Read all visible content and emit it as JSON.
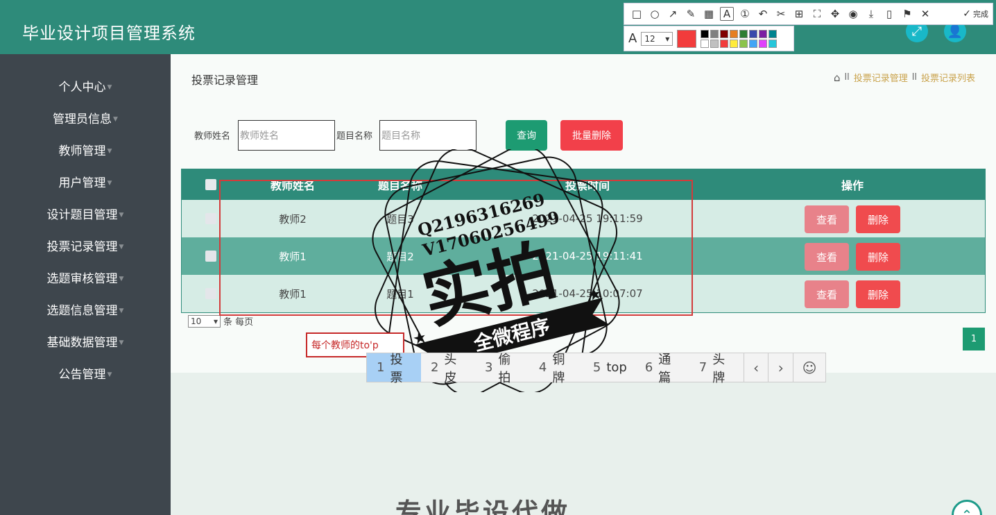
{
  "app": {
    "title": "毕业设计项目管理系统"
  },
  "header": {
    "fullscreen_icon": "expand-icon",
    "user_icon": "user-icon"
  },
  "sidebar": {
    "items": [
      {
        "label": "个人中心"
      },
      {
        "label": "管理员信息"
      },
      {
        "label": "教师管理"
      },
      {
        "label": "用户管理"
      },
      {
        "label": "设计题目管理"
      },
      {
        "label": "投票记录管理"
      },
      {
        "label": "选题审核管理"
      },
      {
        "label": "选题信息管理"
      },
      {
        "label": "基础数据管理"
      },
      {
        "label": "公告管理"
      }
    ]
  },
  "page": {
    "title": "投票记录管理",
    "breadcrumb": {
      "sep": "ll",
      "items": [
        "投票记录管理",
        "投票记录列表"
      ]
    }
  },
  "search": {
    "teacher_label": "教师姓名",
    "teacher_placeholder": "教师姓名",
    "topic_label": "题目名称",
    "topic_placeholder": "题目名称",
    "query_label": "查询",
    "batch_delete_label": "批量删除"
  },
  "table": {
    "headers": {
      "teacher": "教师姓名",
      "topic": "题目名称",
      "time": "投票时间",
      "actions": "操作"
    },
    "rows": [
      {
        "teacher": "教师2",
        "topic": "题目3",
        "time": "2021-04-25 19:11:59"
      },
      {
        "teacher": "教师1",
        "topic": "题目2",
        "time": "2021-04-25 19:11:41"
      },
      {
        "teacher": "教师1",
        "topic": "题目1",
        "time": "2021-04-25 10:07:07"
      }
    ],
    "view_label": "查看",
    "delete_label": "删除"
  },
  "pagination": {
    "page_size": "10",
    "page_size_suffix": "条 每页",
    "current_page": "1"
  },
  "ime": {
    "composition": "每个教师的to'p",
    "candidates": [
      {
        "n": "1",
        "text": "投票"
      },
      {
        "n": "2",
        "text": "头皮"
      },
      {
        "n": "3",
        "text": "偷拍"
      },
      {
        "n": "4",
        "text": "铜牌"
      },
      {
        "n": "5",
        "text": "top"
      },
      {
        "n": "6",
        "text": "通篇"
      },
      {
        "n": "7",
        "text": "头牌"
      }
    ]
  },
  "screenshot_tool": {
    "done_label": "完成",
    "font_size": "12",
    "current_color": "#f23c3c",
    "palette": [
      "#000000",
      "#808080",
      "#800000",
      "#e67e22",
      "#2e7d32",
      "#3949ab",
      "#7b1fa2",
      "#00838f",
      "#ffffff",
      "#c0c0c0",
      "#f23c3c",
      "#ffeb3b",
      "#8bc34a",
      "#42a5f5",
      "#e040fb",
      "#26c6da"
    ]
  },
  "watermark": {
    "line1": "Q2196316269",
    "line2": "V17060256499",
    "main": "实拍",
    "ribbon": "全微程序"
  },
  "promo": {
    "text": "专业毕设代做"
  },
  "colors": {
    "primary": "#2e8b7a",
    "sidebar": "#3e464d",
    "danger": "#f04b4e",
    "view": "#e8828a"
  }
}
